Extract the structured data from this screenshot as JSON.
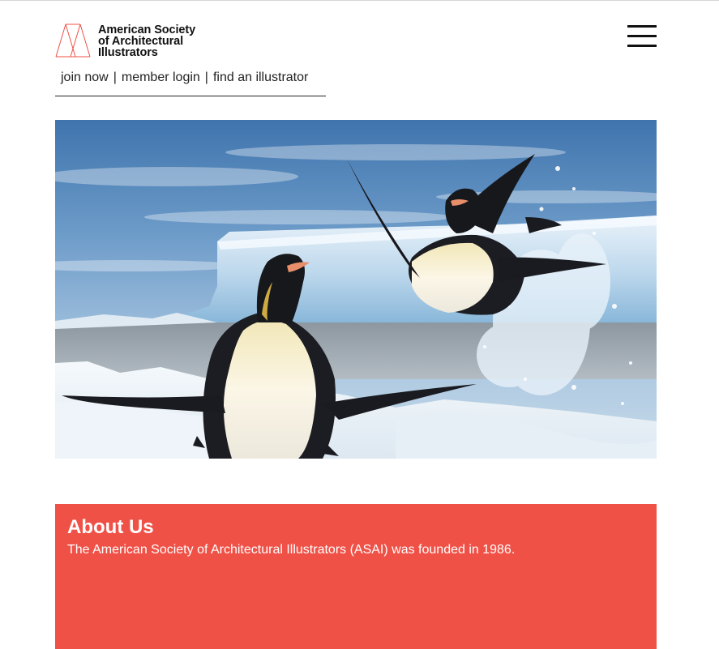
{
  "header": {
    "logo": {
      "line1": "American Society",
      "line2": "of Architectural",
      "line3": "Illustrators"
    },
    "menu_icon": "hamburger-menu-icon"
  },
  "nav": {
    "join_label": "join now",
    "login_label": "member login",
    "find_label": "find an illustrator",
    "separator": "|"
  },
  "hero": {
    "subject": "emperor penguins on ice"
  },
  "about": {
    "title": "About Us",
    "text": "The American Society of Architectural Illustrators (ASAI) was founded in 1986."
  },
  "colors": {
    "brand_red": "#ef5147",
    "text": "#111111"
  }
}
